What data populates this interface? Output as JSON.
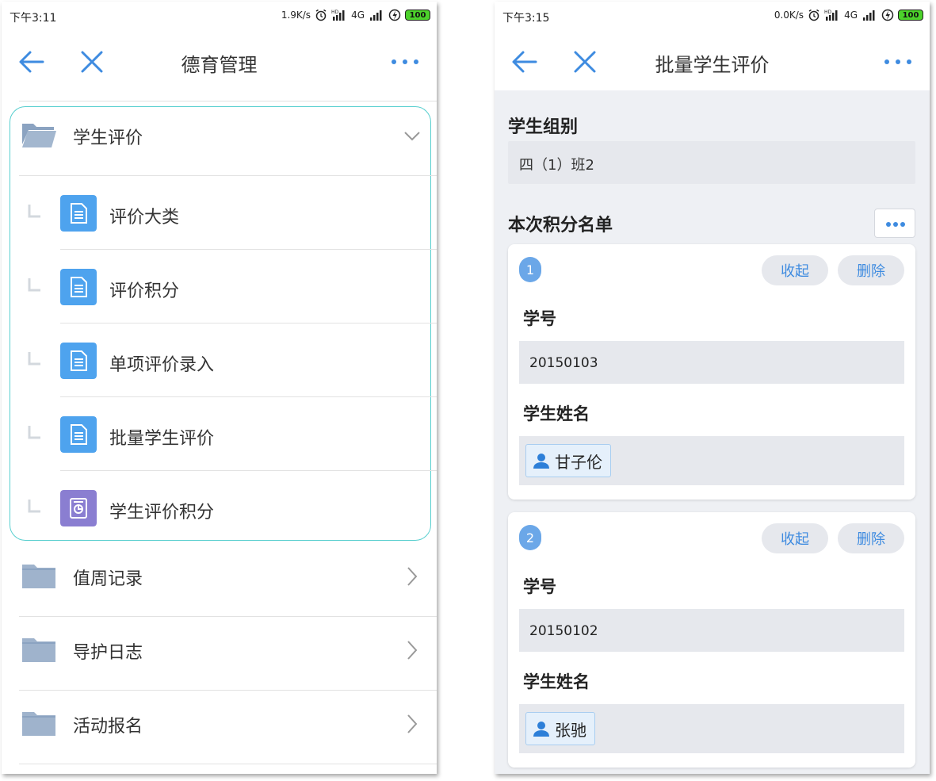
{
  "left": {
    "status": {
      "time": "下午3:11",
      "speed": "1.9K/s",
      "network": "4G",
      "battery": "100"
    },
    "nav": {
      "title": "德育管理"
    },
    "groups": [
      {
        "label": "学生评价",
        "expanded": true
      },
      {
        "label": "值周记录",
        "expanded": false
      },
      {
        "label": "导护日志",
        "expanded": false
      },
      {
        "label": "活动报名",
        "expanded": false
      }
    ],
    "children": [
      {
        "label": "评价大类",
        "icon": "document-icon",
        "color": "#4ea3ee"
      },
      {
        "label": "评价积分",
        "icon": "document-icon",
        "color": "#4ea3ee"
      },
      {
        "label": "单项评价录入",
        "icon": "document-icon",
        "color": "#4ea3ee"
      },
      {
        "label": "批量学生评价",
        "icon": "document-icon",
        "color": "#4ea3ee"
      },
      {
        "label": "学生评价积分",
        "icon": "report-icon",
        "color": "#8a7ed1"
      }
    ]
  },
  "right": {
    "status": {
      "time": "下午3:15",
      "speed": "0.0K/s",
      "network": "4G",
      "battery": "100"
    },
    "nav": {
      "title": "批量学生评价"
    },
    "group_section": {
      "label": "学生组别",
      "value": "四（1）班2"
    },
    "list_section": {
      "label": "本次积分名单"
    },
    "cards": [
      {
        "index": "1",
        "collapse_label": "收起",
        "delete_label": "删除",
        "id_label": "学号",
        "id_value": "20150103",
        "name_label": "学生姓名",
        "name_value": "甘子伦"
      },
      {
        "index": "2",
        "collapse_label": "收起",
        "delete_label": "删除",
        "id_label": "学号",
        "id_value": "20150102",
        "name_label": "学生姓名",
        "name_value": "张驰"
      }
    ]
  },
  "colors": {
    "accent": "#3e8be0",
    "frame": "#58cfcf",
    "folder": "#9fb3cc",
    "doc_icon": "#4ea3ee",
    "report_icon": "#8a7ed1",
    "battery": "#4cd22b"
  }
}
